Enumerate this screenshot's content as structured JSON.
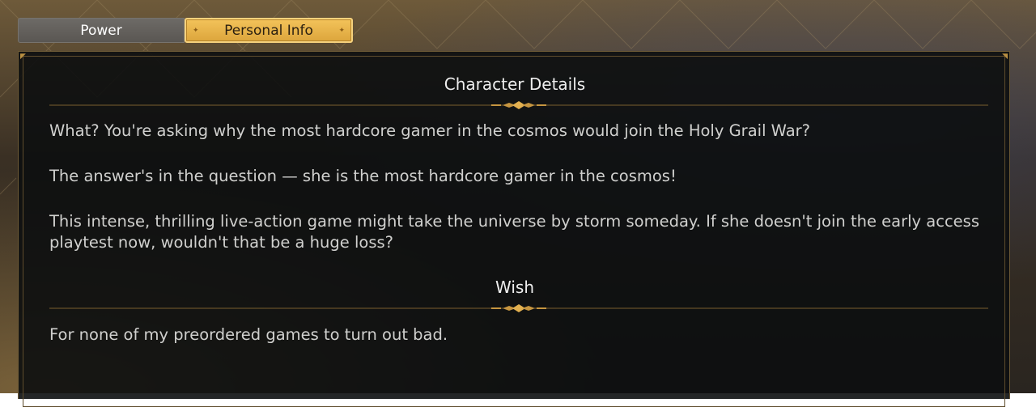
{
  "tabs": [
    {
      "label": "Power",
      "active": false
    },
    {
      "label": "Personal Info",
      "active": true
    }
  ],
  "character_details": {
    "title": "Character Details",
    "paragraphs": [
      "What? You're asking why the most hardcore gamer in the cosmos would join the Holy Grail War?",
      "The answer's in the question — she is the most hardcore gamer in the cosmos!",
      "This intense, thrilling live-action game might take the universe by storm someday. If she doesn't join the early access playtest now, wouldn't that be a huge loss?"
    ]
  },
  "wish": {
    "title": "Wish",
    "text": "For none of my preordered games to turn out bad."
  },
  "colors": {
    "accent_gold": "#e4b04a",
    "divider_gold": "#8a6a30",
    "inactive_tab": "#64615d",
    "panel_bg": "#0c0e10"
  }
}
